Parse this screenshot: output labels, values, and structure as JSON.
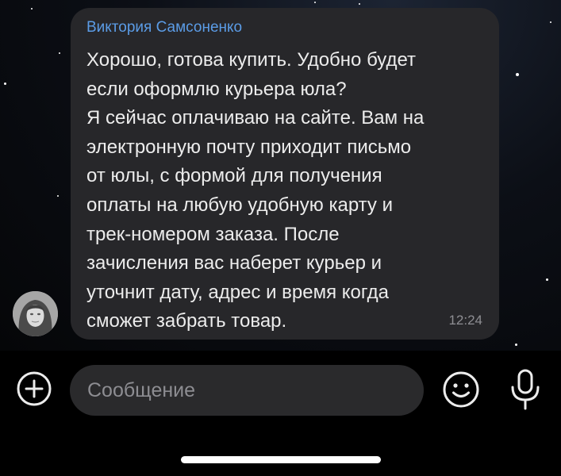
{
  "message": {
    "sender": "Виктория Самсоненко",
    "text": "Хорошо, готова купить. Удобно будет\nесли оформлю курьера юла?\nЯ сейчас оплачиваю на сайте. Вам на\nэлектронную почту приходит письмо\nот юлы, с формой для получения\nоплаты на любую удобную карту и\nтрек-номером заказа. После\nзачисления вас наберет курьер и\nуточнит дату, адрес и время когда\nсможет забрать товар.",
    "time": "12:24"
  },
  "composer": {
    "placeholder": "Сообщение",
    "icons": [
      "plus-circle-icon",
      "smiley-icon",
      "microphone-icon"
    ]
  },
  "colors": {
    "sender_name": "#5b9ce6",
    "bubble": "#27272a",
    "input_field": "#2a2a2c"
  }
}
